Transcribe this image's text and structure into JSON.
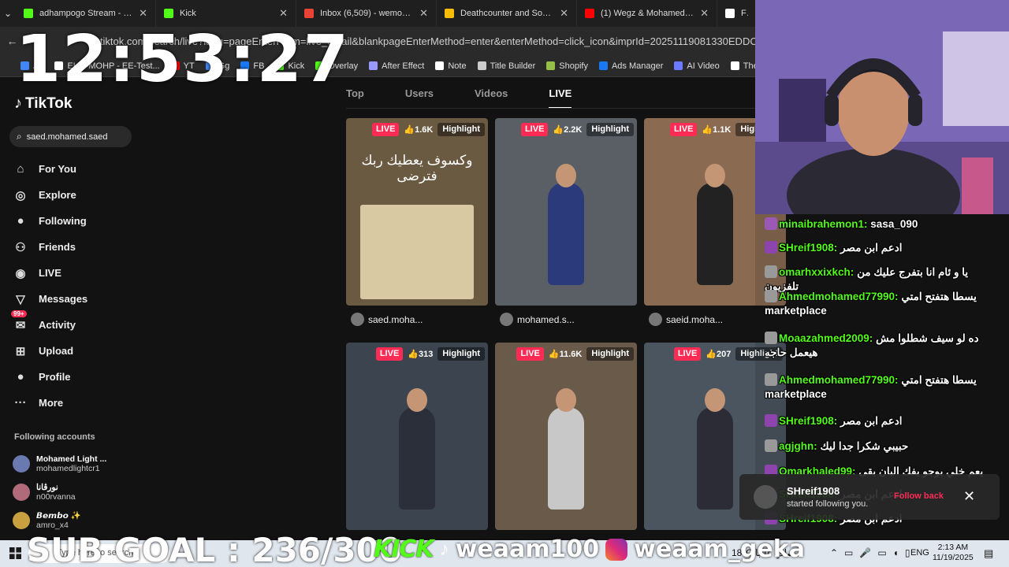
{
  "browser": {
    "tabs": [
      {
        "label": "adhampogo Stream - Wat",
        "color": "#53fc18"
      },
      {
        "label": "Kick",
        "color": "#53fc18"
      },
      {
        "label": "Inbox (6,509) - wemo148@",
        "color": "#ea4335"
      },
      {
        "label": "Deathcounter and Soundb",
        "color": "#fbbc04"
      },
      {
        "label": "(1) Wegz & Mohamed Mo",
        "color": "#ff0000"
      },
      {
        "label": "Fi",
        "color": "#ffffff"
      }
    ],
    "url": "tiktok.com/search/live?lang=pageEnterFrom=live_detail&blankpageEnterMethod=enter&enterMethod=click_icon&imprId=20251119081330EDDC591788D83A3",
    "bookmarks": [
      {
        "label": "Ap",
        "color": "#4285f4"
      },
      {
        "label": "EHC-MOHP - EE-Test...",
        "color": "#ffffff"
      },
      {
        "label": "YT",
        "color": "#ff0000"
      },
      {
        "label": "Gg",
        "color": "#4285f4"
      },
      {
        "label": "FB",
        "color": "#1877f2"
      },
      {
        "label": "Kick",
        "color": "#53fc18"
      },
      {
        "label": "Overlay",
        "color": "#53fc18"
      },
      {
        "label": "After Effect",
        "color": "#9999ff"
      },
      {
        "label": "Note",
        "color": "#ffffff"
      },
      {
        "label": "Title Builder",
        "color": "#cccccc"
      },
      {
        "label": "Shopify",
        "color": "#95bf47"
      },
      {
        "label": "Ads Manager",
        "color": "#1877f2"
      },
      {
        "label": "AI Video",
        "color": "#6b7bff"
      },
      {
        "label": "The",
        "color": "#ffffff"
      }
    ]
  },
  "overlay": {
    "clock": "12:53:27",
    "sub_goal": "SUB GOAL : 236/300",
    "kick_label": "KICK",
    "kick_handle": "weaam100",
    "ig_handle": "weaam_geka"
  },
  "tiktok": {
    "logo": "TikTok",
    "search": "saed.mohamed.saed",
    "nav": [
      {
        "label": "For You",
        "icon": "home-icon",
        "glyph": "⌂"
      },
      {
        "label": "Explore",
        "icon": "compass-icon",
        "glyph": "◎"
      },
      {
        "label": "Following",
        "icon": "following-icon",
        "glyph": "●"
      },
      {
        "label": "Friends",
        "icon": "friends-icon",
        "glyph": "⚇"
      },
      {
        "label": "LIVE",
        "icon": "live-icon",
        "glyph": "◉"
      },
      {
        "label": "Messages",
        "icon": "messages-icon",
        "glyph": "▽"
      },
      {
        "label": "Activity",
        "icon": "activity-icon",
        "glyph": "✉",
        "badge": "99+"
      },
      {
        "label": "Upload",
        "icon": "upload-icon",
        "glyph": "⊞"
      },
      {
        "label": "Profile",
        "icon": "profile-icon",
        "glyph": "●"
      },
      {
        "label": "More",
        "icon": "more-icon",
        "glyph": "···"
      }
    ],
    "following_title": "Following accounts",
    "following": [
      {
        "display": "Mohamed Light ...",
        "user": "mohamedlightcr1",
        "color": "#6a7ab0"
      },
      {
        "display": "نورڤانا",
        "user": "n00rvanna",
        "color": "#b06a7a"
      },
      {
        "display": "𝘽𝙚𝙢𝙗𝙤 ✨",
        "user": "amro_x4",
        "color": "#c8a040"
      }
    ],
    "tabs": [
      "Top",
      "Users",
      "Videos",
      "LIVE"
    ],
    "active_tab": "LIVE",
    "cards": [
      {
        "live": "LIVE",
        "likes": "👍1.6K",
        "highlight": "Highlight",
        "owner": "saed.moha...",
        "bg": "#6b5a42",
        "overlay_text": "وكسوف يعطيك ربك فترضى"
      },
      {
        "live": "LIVE",
        "likes": "👍2.2K",
        "highlight": "Highlight",
        "owner": "mohamed.s...",
        "bg": "#5a5f66"
      },
      {
        "live": "LIVE",
        "likes": "👍1.1K",
        "highlight": "Highlight",
        "owner": "saeid.moha...",
        "bg": "#8a6b52"
      },
      {
        "live": "LIVE",
        "likes": "👍313",
        "highlight": "Highlight",
        "owner": "",
        "bg": "#3c4450"
      },
      {
        "live": "LIVE",
        "likes": "👍11.6K",
        "highlight": "Highlight",
        "owner": "",
        "bg": "#6a5a4a"
      },
      {
        "live": "LIVE",
        "likes": "👍207",
        "highlight": "Highlight",
        "owner": "",
        "bg": "#4a5560"
      }
    ]
  },
  "chat": [
    {
      "user": "minaibrahemon1:",
      "text": "sasa_090",
      "color": "#9b59b6"
    },
    {
      "user": "SHreif1908:",
      "text": "ادعم ابن مصر",
      "color": "#8e44ad"
    },
    {
      "user": "omarhxxixkch:",
      "text": "يا و ئام انا بتفرج عليك من تلفزيون",
      "color": "#999999"
    },
    {
      "user": "Ahmedmohamed77990:",
      "text": "يسطا هتفتح امتي marketplace",
      "color": "#999999"
    },
    {
      "user": "Moaazahmed2009:",
      "text": "ده لو سيف شطلوا مش هيعمل حاجه",
      "color": "#999999"
    },
    {
      "user": "Ahmedmohamed77990:",
      "text": "يسطا هتفتح امتي marketplace",
      "color": "#999999"
    },
    {
      "user": "SHreif1908:",
      "text": "ادعم ابن مصر",
      "color": "#8e44ad"
    },
    {
      "user": "agjghn:",
      "text": "حبيبي شكرا جدا ليك",
      "color": "#999999"
    },
    {
      "user": "Omarkhaled99:",
      "text": "يعم خلي بوجو يفك البان بقى",
      "color": "#8e44ad"
    },
    {
      "user": "SHreif1908:",
      "text": "ادعم ابن مصر",
      "color": "#8e44ad"
    },
    {
      "user": "SHreif1908:",
      "text": "ادعم ابن مصر",
      "color": "#8e44ad"
    }
  ],
  "toast": {
    "name": "SHreif1908",
    "message": "started following you.",
    "action": "Follow back"
  },
  "taskbar": {
    "search_placeholder": "Type here to search",
    "weather": "18°C  صافٍ غالبًا",
    "lang": "ENG",
    "time": "2:13 AM",
    "date": "11/19/2025"
  }
}
